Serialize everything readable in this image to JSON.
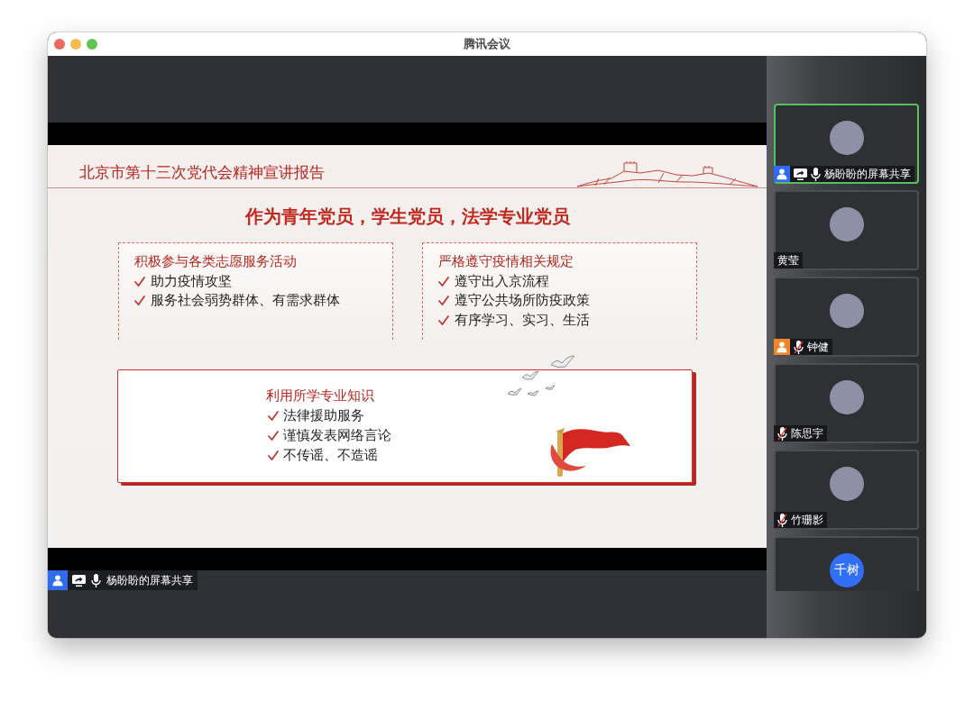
{
  "window": {
    "title": "腾讯会议"
  },
  "shared_screen": {
    "slide": {
      "header": "北京市第十三次党代会精神宣讲报告",
      "heading": "作为青年党员，学生党员，法学专业党员",
      "panels": [
        {
          "kind": "dashed",
          "title": "积极参与各类志愿服务活动",
          "items": [
            "助力疫情攻坚",
            "服务社会弱势群体、有需求群体"
          ]
        },
        {
          "kind": "dashed",
          "title": "严格遵守疫情相关规定",
          "items": [
            "遵守出入京流程",
            "遵守公共场所防疫政策",
            "有序学习、实习、生活"
          ]
        },
        {
          "kind": "framed",
          "title": "利用所学专业知识",
          "items": [
            "法律援助服务",
            "谨慎发表网络言论",
            "不传谣、不造谣"
          ]
        }
      ]
    },
    "presenter": {
      "badge": {
        "color": "#2f6cf5"
      },
      "sharing": true,
      "muted": false,
      "label": "杨盼盼的屏幕共享"
    }
  },
  "participants": [
    {
      "label": "杨盼盼的屏幕共享",
      "selected": true,
      "badge": {
        "color": "#2f6cf5"
      },
      "sharing": true,
      "muted": false,
      "avatar": {
        "kind": "photo"
      }
    },
    {
      "label": "黄莹",
      "selected": false,
      "avatar": {
        "kind": "photo"
      }
    },
    {
      "label": "钟健",
      "selected": false,
      "badge": {
        "color": "#f2852a"
      },
      "muted": true,
      "avatar": {
        "kind": "photo"
      }
    },
    {
      "label": "陈思宇",
      "selected": false,
      "muted": true,
      "avatar": {
        "kind": "photo"
      }
    },
    {
      "label": "竹珊影",
      "selected": false,
      "muted": true,
      "avatar": {
        "kind": "photo"
      }
    },
    {
      "selected": false,
      "avatar": {
        "kind": "initials",
        "text": "千树"
      }
    }
  ]
}
